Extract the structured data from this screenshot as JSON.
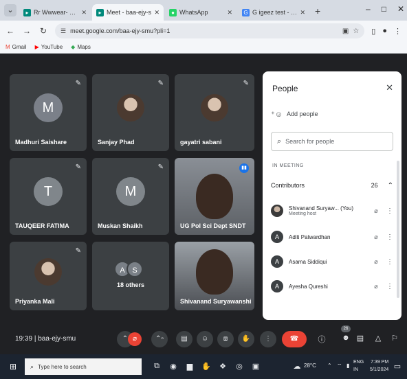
{
  "browser": {
    "tabs": [
      {
        "label": "Rr Wwwear- sunymans",
        "active": false,
        "favicon": "meet-icon"
      },
      {
        "label": "Meet - baa-ejy-s",
        "active": true,
        "favicon": "meet-icon"
      },
      {
        "label": "WhatsApp",
        "active": false,
        "favicon": "whatsapp-icon"
      },
      {
        "label": "G igeez test - Google S",
        "active": false,
        "favicon": "google-icon"
      }
    ],
    "url": "meet.google.com/baa-ejy-smu?pli=1",
    "bookmarks": [
      {
        "label": "Gmail",
        "icon": "gmail-icon"
      },
      {
        "label": "YouTube",
        "icon": "youtube-icon"
      },
      {
        "label": "Maps",
        "icon": "maps-icon"
      }
    ]
  },
  "meeting": {
    "time": "19:39",
    "code": "baa-ejy-smu",
    "separator": "|",
    "tiles": [
      {
        "name": "Madhuri Saishare",
        "initial": "M",
        "color": "#7b8089",
        "type": "initial"
      },
      {
        "name": "Sanjay Phad",
        "initial": "",
        "color": "",
        "type": "photo"
      },
      {
        "name": "gayatri sabani",
        "initial": "",
        "color": "",
        "type": "photo"
      },
      {
        "name": "TAUQEER FATIMA",
        "initial": "T",
        "color": "#80868b",
        "type": "initial"
      },
      {
        "name": "Muskan Shaikh",
        "initial": "M",
        "color": "#80868b",
        "type": "initial"
      },
      {
        "name": "UG Pol Sci Dept SNDT",
        "initial": "",
        "color": "",
        "type": "video"
      },
      {
        "name": "Priyanka Mali",
        "initial": "",
        "color": "",
        "type": "photo"
      },
      {
        "name": "18 others",
        "initial": "",
        "color": "",
        "type": "others",
        "stack": [
          "A",
          "S"
        ]
      },
      {
        "name": "Shivanand Suryawanshi",
        "initial": "",
        "color": "",
        "type": "video"
      }
    ]
  },
  "people_panel": {
    "title": "People",
    "close_icon": "close-icon",
    "add_people": "Add people",
    "search_placeholder": "Search for people",
    "section": "IN MEETING",
    "group_label": "Contributors",
    "group_count": "26",
    "participants": [
      {
        "name": "Shivanand Suryaw... (You)",
        "role": "Meeting host",
        "avatar": "",
        "photo": true
      },
      {
        "name": "Aditi Patwardhan",
        "role": "",
        "avatar": "A",
        "photo": false
      },
      {
        "name": "Asama Siddiqui",
        "role": "",
        "avatar": "A",
        "photo": false
      },
      {
        "name": "Ayesha Qureshi",
        "role": "",
        "avatar": "A",
        "photo": false
      }
    ]
  },
  "controls": {
    "people_count": "26",
    "icons": [
      "arrow-up-icon",
      "mic-off-icon",
      "camera-icon",
      "captions-icon",
      "emoji-icon",
      "present-icon",
      "raise-hand-icon",
      "more-icon",
      "hang-up-icon",
      "info-icon",
      "people-icon",
      "chat-icon",
      "activities-icon",
      "host-controls-icon"
    ]
  },
  "taskbar": {
    "search_placeholder": "Type here to search",
    "temperature": "28°C",
    "lang": "ENG",
    "region": "IN",
    "time": "7:39 PM",
    "date": "5/1/2024"
  }
}
